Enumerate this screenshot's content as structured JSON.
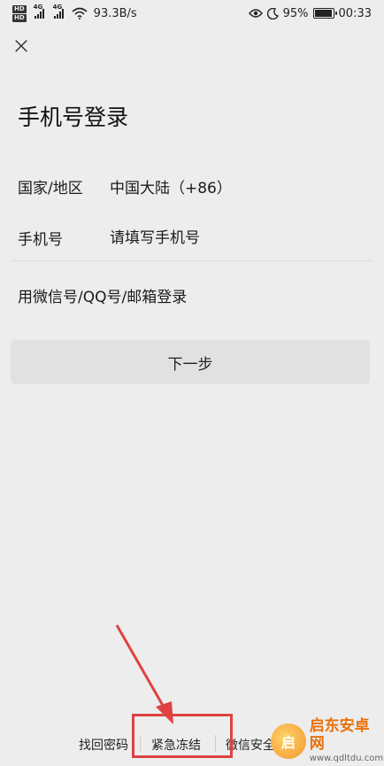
{
  "status_bar": {
    "hd1": "HD",
    "hd2": "HD",
    "net1": "4G",
    "net2": "4G",
    "speed": "93.3B/s",
    "battery": "95%",
    "time": "00:33"
  },
  "header": {
    "close_icon": "×"
  },
  "page_title": "手机号登录",
  "form": {
    "region_label": "国家/地区",
    "region_value": "中国大陆（+86）",
    "phone_label": "手机号",
    "phone_placeholder": "请填写手机号",
    "alt_login": "用微信号/QQ号/邮箱登录",
    "next_button": "下一步"
  },
  "bottom_links": {
    "find_password": "找回密码",
    "emergency_freeze": "紧急冻结",
    "wechat_security": "微信安全中心"
  },
  "watermark": {
    "logo_letter": "启",
    "title": "启东安卓网",
    "url": "www.qdltdu.com"
  },
  "colors": {
    "background": "#ededed",
    "annotation": "#e04141",
    "watermark": "#e8710a"
  }
}
